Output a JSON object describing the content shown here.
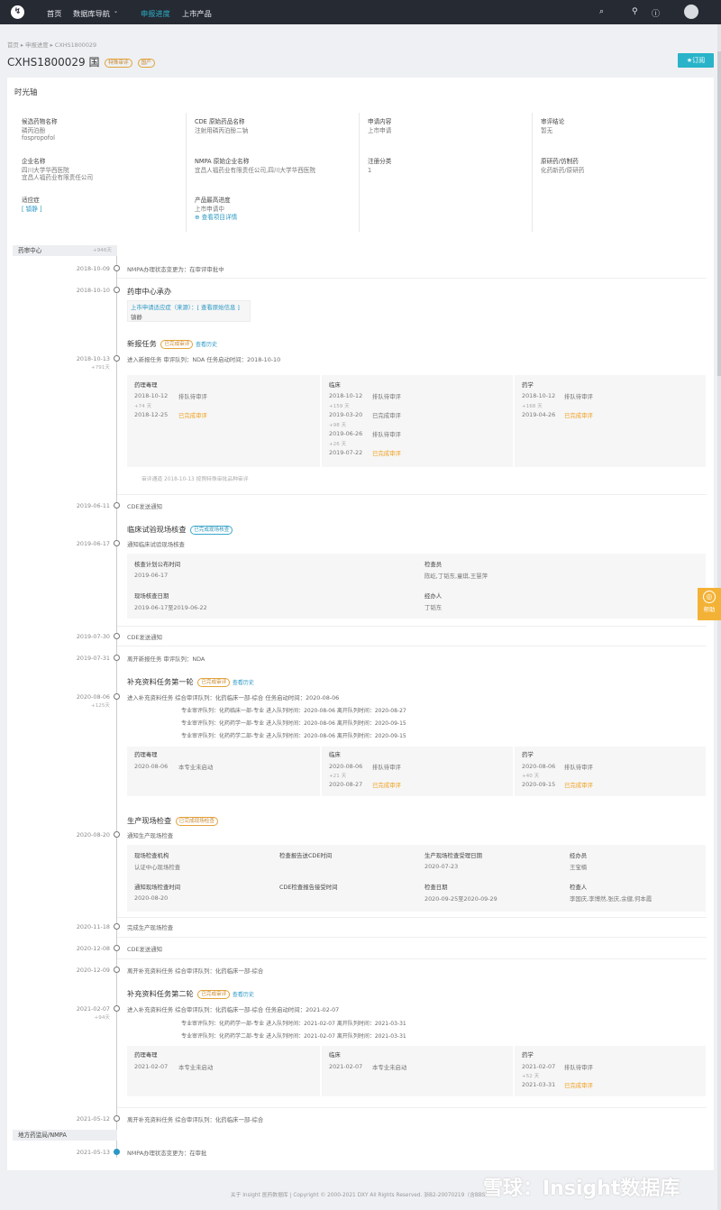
{
  "nav": {
    "items": [
      "首页",
      "数据库导航",
      "申报进度",
      "上市产品"
    ]
  },
  "header": {
    "breadcrumb": "首页 ▸ 申报进度 ▸ CXHS1800029",
    "title": "CXHS1800029 国",
    "tags": [
      "特殊审评",
      "国产"
    ],
    "subscribe": "★订阅"
  },
  "info": {
    "section": "时光轴",
    "f": [
      [
        "候选药物名称",
        "磷丙泊酚",
        "fospropofol"
      ],
      [
        "CDE 原始药品名称",
        "注射用磷丙泊酚二钠",
        ""
      ],
      [
        "申请内容",
        "上市申请",
        ""
      ],
      [
        "审评结论",
        "暂无",
        ""
      ],
      [
        "企业名称",
        "四川大学华西医院",
        "宜昌人福药业有限责任公司"
      ],
      [
        "NMPA 原始企业名称",
        "宜昌人福药业有限责任公司,四川大学华西医院",
        ""
      ],
      [
        "注册分类",
        "1",
        ""
      ],
      [
        "原研药/仿制药",
        "化药新药/原研药",
        ""
      ],
      [
        "适应症",
        "[ 镇静 ]",
        ""
      ],
      [
        "产品最高进度",
        "上市申请中",
        "查看项目详情"
      ]
    ]
  },
  "sec1": {
    "label": "药审中心",
    "n": "+946天"
  },
  "sec2": {
    "label": "地方药监局/NMPA"
  },
  "tl": {
    "d1": "2018-10-09",
    "e1": "NMPA办理状态变更为：在审评审批中",
    "d2": "2018-10-10",
    "h2": "药审中心承办",
    "e2a": "上市申请适应症（来源）：[ 查看原始信息 ]",
    "e2b": "镇静",
    "h3": "新报任务",
    "t3": "已完成审评",
    "l3": "查看历史",
    "d3": "2018-10-13",
    "n3": "+791天",
    "e3": "进入新报任务  审评队列：NDA  任务启动时间：2018-10-10",
    "g3": [
      [
        "药理毒理",
        "2018-10-12",
        "排队待审评",
        "+74 天",
        "2018-12-25",
        "已完成审评",
        "",
        ""
      ],
      [
        "临床",
        "2018-10-12",
        "排队待审评",
        "+159 天",
        "2019-03-20",
        "已完成审评",
        "+98 天",
        "2019-06-26",
        "排队待审评",
        "+26 天",
        "2019-07-22",
        "已完成审评"
      ],
      [
        "药学",
        "2018-10-12",
        "排队待审评",
        "+168 天",
        "2019-04-26",
        "已完成审评"
      ]
    ],
    "f3": "审评通道   2018-10-13    按照特殊审批品种审评",
    "d4": "2019-06-11",
    "e4": "CDE发送通知",
    "h5": "临床试验现场核查",
    "t5": "已完成现场核查",
    "d5": "2019-06-17",
    "e5": "通知临床试验现场核查",
    "g5": [
      [
        "核查计划公布时间",
        "2019-06-17"
      ],
      [
        "检查员",
        "陈屹,丁韬东,童琪,王慧萍"
      ],
      [
        "现场核查日期",
        "2019-06-17至2019-06-22"
      ],
      [
        "经办人",
        "丁韬东"
      ]
    ],
    "d6": "2019-07-30",
    "e6": "CDE发送通知",
    "d7": "2019-07-31",
    "e7": "离开新报任务  审评队列：NDA",
    "h8": "补充资料任务第一轮",
    "t8": "已完成审评",
    "l8": "查看历史",
    "d8": "2020-08-06",
    "n8": "+125天",
    "e8": "进入补充资料任务  综合审评队列：化药临床一部-综合  任务启动时间：2020-08-06",
    "q8": [
      "专业审评队列：化药临床一部-专业  进入队列时间：2020-08-06  离开队列时间：2020-08-27",
      "专业审评队列：化药药学一部-专业  进入队列时间：2020-08-06  离开队列时间：2020-09-15",
      "专业审评队列：化药药学二部-专业  进入队列时间：2020-08-06  离开队列时间：2020-09-15"
    ],
    "g8": [
      [
        "药理毒理",
        "2020-08-06",
        "本专业未启动"
      ],
      [
        "临床",
        "2020-08-06",
        "排队待审评",
        "+21 天",
        "2020-08-27",
        "已完成审评"
      ],
      [
        "药学",
        "2020-08-06",
        "排队待审评",
        "+40 天",
        "2020-09-15",
        "已完成审评"
      ]
    ],
    "h9": "生产现场检查",
    "t9": "已完成现场检查",
    "d9": "2020-08-20",
    "e9": "通知生产现场检查",
    "g9": [
      [
        "现场检查机构",
        "认证中心现场检查"
      ],
      [
        "检查报告送CDE时间",
        ""
      ],
      [
        "生产现场检查受理日期",
        "2020-07-23"
      ],
      [
        "经办员",
        "王宝楠"
      ],
      [
        "通知现场检查时间",
        "2020-08-20"
      ],
      [
        "CDE检查报告接受时间",
        ""
      ],
      [
        "检查日期",
        "2020-09-25至2020-09-29"
      ],
      [
        "检查人",
        "李国庆,李博然,张庆,余健,何本霞"
      ]
    ],
    "d10": "2020-11-18",
    "e10": "完成生产现场检查",
    "d11": "2020-12-08",
    "e11": "CDE发送通知",
    "d12": "2020-12-09",
    "e12": "离开补充资料任务  综合审评队列：化药临床一部-综合",
    "h13": "补充资料任务第二轮",
    "t13": "已完成审评",
    "l13": "查看历史",
    "d13": "2021-02-07",
    "n13": "+94天",
    "e13": "进入补充资料任务  综合审评队列：化药临床一部-综合  任务启动时间：2021-02-07",
    "q13": [
      "专业审评队列：化药药学一部-专业  进入队列时间：2021-02-07  离开队列时间：2021-03-31",
      "专业审评队列：化药药学二部-专业  进入队列时间：2021-02-07  离开队列时间：2021-03-31"
    ],
    "g13": [
      [
        "药理毒理",
        "2021-02-07",
        "本专业未启动"
      ],
      [
        "临床",
        "2021-02-07",
        "本专业未启动"
      ],
      [
        "药学",
        "2021-02-07",
        "排队待审评",
        "+52 天",
        "2021-03-31",
        "已完成审评"
      ]
    ],
    "d14": "2021-05-12",
    "e14": "离开补充资料任务  综合审评队列：化药临床一部-综合",
    "d15": "2021-05-13",
    "e15": "NMPA办理状态变更为：在审批"
  },
  "help": "帮助",
  "footer": "关于 Insight 医药数据库  |  Copyright © 2000-2021 DXY All Rights Reserved. 浙B2-20070219（含BBS）",
  "watermark": "雪球：Insight数据库"
}
